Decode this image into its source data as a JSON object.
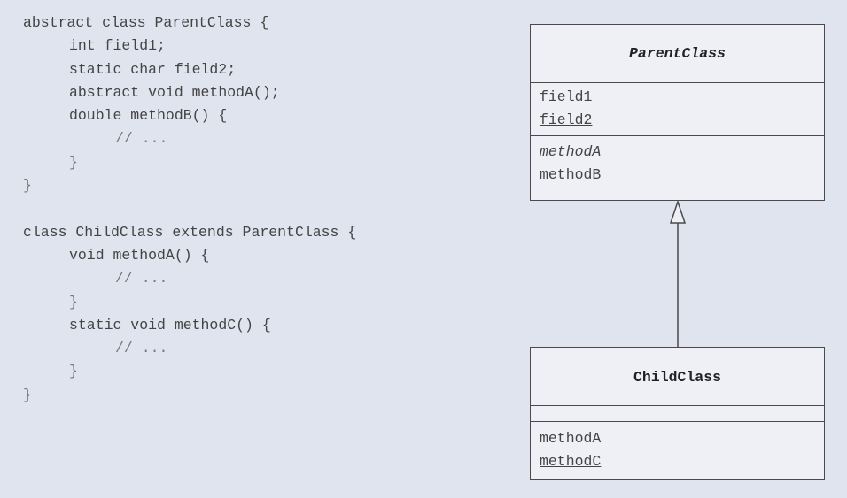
{
  "code": {
    "lines": [
      {
        "text": "abstract class ParentClass {",
        "indent": 0
      },
      {
        "text": "int field1;",
        "indent": 1
      },
      {
        "text": "static char field2;",
        "indent": 1
      },
      {
        "text": "abstract void methodA();",
        "indent": 1
      },
      {
        "text": "double methodB() {",
        "indent": 1
      },
      {
        "text": "// ...",
        "indent": 2
      },
      {
        "text": "}",
        "indent": 1
      },
      {
        "text": "}",
        "indent": 0
      },
      {
        "text": "",
        "indent": 0
      },
      {
        "text": "class ChildClass extends ParentClass {",
        "indent": 0
      },
      {
        "text": "void methodA() {",
        "indent": 1
      },
      {
        "text": "// ...",
        "indent": 2
      },
      {
        "text": "}",
        "indent": 1
      },
      {
        "text": "static void methodC() {",
        "indent": 1
      },
      {
        "text": "// ...",
        "indent": 2
      },
      {
        "text": "}",
        "indent": 1
      },
      {
        "text": "}",
        "indent": 0
      }
    ]
  },
  "uml": {
    "parent": {
      "name": "ParentClass",
      "fields": [
        "field1",
        "field2"
      ],
      "methods": [
        "methodA",
        "methodB"
      ]
    },
    "child": {
      "name": "ChildClass",
      "methods": [
        "methodA",
        "methodC"
      ]
    },
    "relationship": "generalization"
  },
  "colors": {
    "background": "#dfe4ef",
    "box_border": "#4a4a4a",
    "text": "#444444"
  }
}
